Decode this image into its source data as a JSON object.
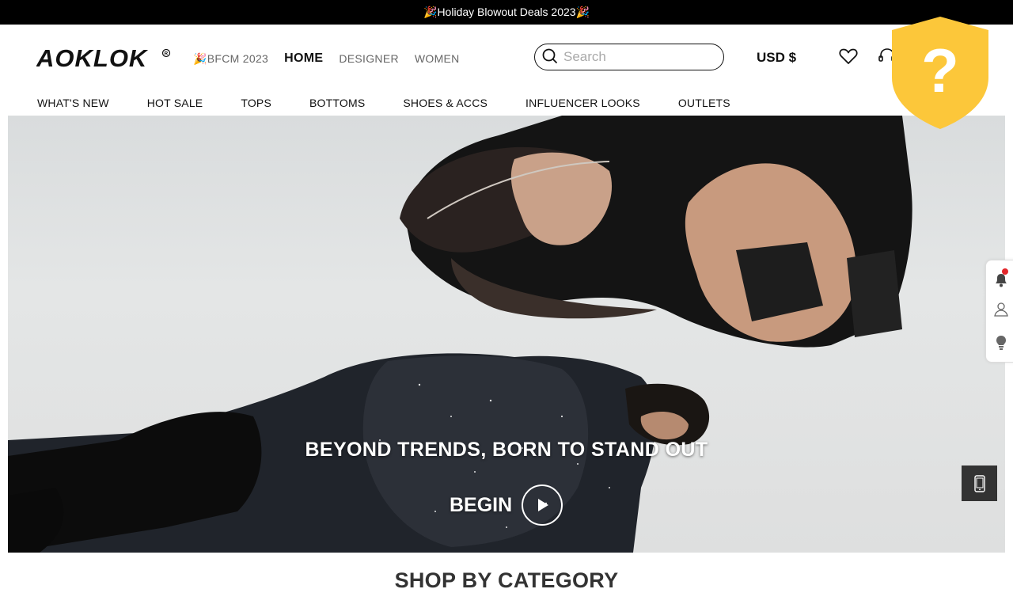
{
  "announcement": {
    "text": "🎉Holiday Blowout Deals 2023🎉"
  },
  "header": {
    "logo_text": "AOKLOK",
    "top_nav": [
      "🎉BFCM 2023",
      "HOME",
      "DESIGNER",
      "WOMEN"
    ],
    "active_top_nav": "HOME",
    "search_placeholder": "Search",
    "currency": "USD $",
    "icons": [
      "search-icon",
      "heart-icon",
      "headset-icon"
    ]
  },
  "category_nav": [
    "WHAT'S NEW",
    "HOT SALE",
    "TOPS",
    "BOTTOMS",
    "SHOES & ACCS",
    "INFLUENCER LOOKS",
    "OUTLETS"
  ],
  "shield_overlay": {
    "symbol": "?",
    "color": "#FCC73A"
  },
  "hero": {
    "headline": "BEYOND TRENDS, BORN TO STAND OUT",
    "cta_label": "BEGIN",
    "cta_icon": "play-icon"
  },
  "side_widgets": [
    "bell-icon",
    "person-icon",
    "lightbulb-icon"
  ],
  "floating_button": {
    "icon": "mobile-phone-icon"
  },
  "section": {
    "title": "SHOP BY CATEGORY"
  },
  "colors": {
    "announcement_bg": "#000000",
    "text": "#111111",
    "muted": "#666666",
    "notification_dot": "#e3262b",
    "shield": "#FCC73A"
  }
}
